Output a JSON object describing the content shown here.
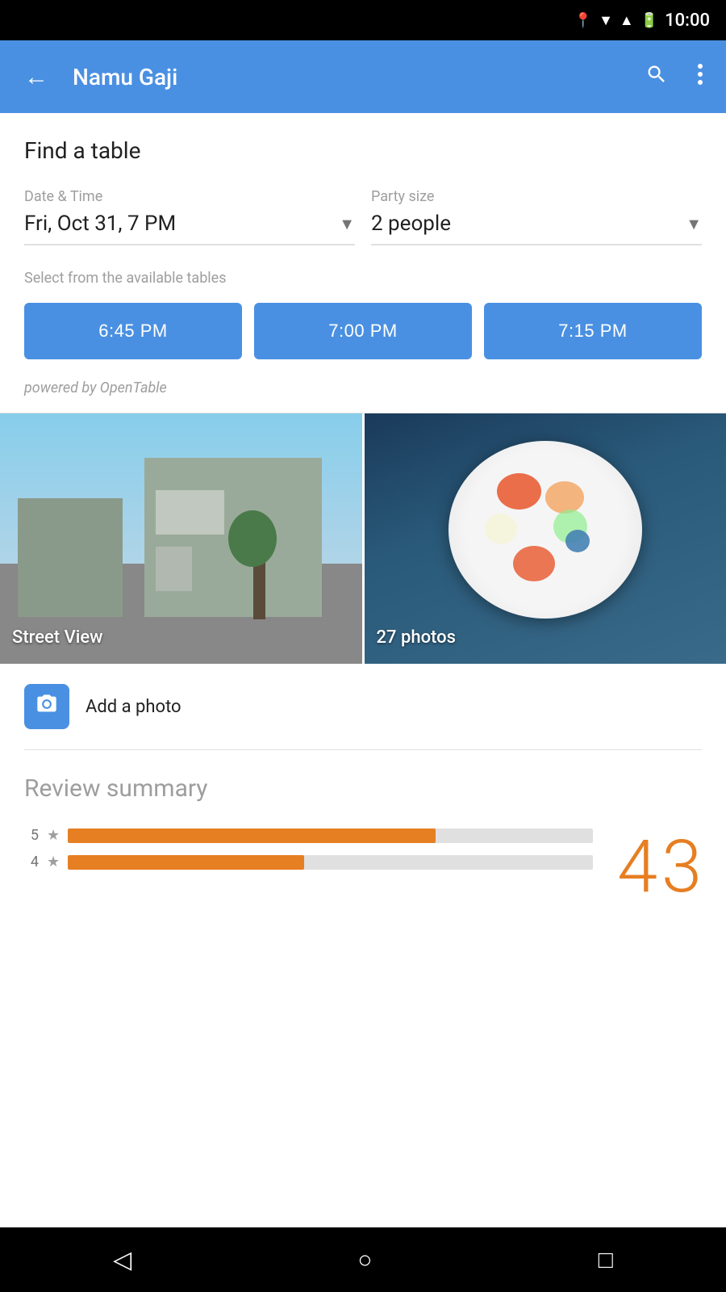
{
  "statusBar": {
    "time": "10:00"
  },
  "appBar": {
    "title": "Namu Gaji",
    "backLabel": "←",
    "searchLabel": "🔍",
    "moreLabel": "⋮"
  },
  "findTable": {
    "sectionTitle": "Find a table",
    "dateLabel": "Date & Time",
    "dateValue": "Fri, Oct 31, 7 PM",
    "partySizeLabel": "Party size",
    "partySizeValue": "2 people",
    "availableLabel": "Select from the available tables",
    "timeSlots": [
      "6:45 PM",
      "7:00 PM",
      "7:15 PM"
    ],
    "poweredBy": "powered by OpenTable"
  },
  "photos": {
    "streetViewLabel": "Street View",
    "photosLabel": "27 photos",
    "addPhotoLabel": "Add a photo"
  },
  "reviewSummary": {
    "title": "Review summary",
    "rating": "4",
    "ratingDecimal": "3",
    "bars": [
      {
        "stars": "5",
        "width": 70
      },
      {
        "stars": "4",
        "width": 45
      }
    ]
  },
  "navBar": {
    "backIcon": "◁",
    "homeIcon": "○",
    "recentIcon": "□"
  }
}
